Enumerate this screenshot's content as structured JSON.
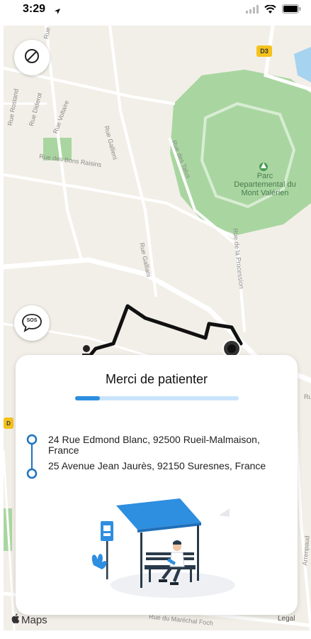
{
  "status_bar": {
    "time": "3:29",
    "location_icon": "navigation-arrow-icon",
    "signal_icon": "signal-bars-icon",
    "wifi_icon": "wifi-icon",
    "battery_icon": "battery-icon"
  },
  "map": {
    "road_labels": {
      "rue_gallieni_top": "Rue Gallieni",
      "rue_gallieni_mid": "Rue Gallieni",
      "rue_diderot": "Rue Diderot",
      "rue_rostand": "Rue Rostand",
      "rue_voltaire": "Rue Voltaire",
      "rue_bons_raisins": "Rue des Bons Raisins",
      "rue_talus": "Rue des Talus",
      "rue_galliani": "Rue Galliani",
      "rue_procession": "Rue de la Procession",
      "rue_marechal_foch": "Rue du Maréchal Foch",
      "arrenpaud": "Arrenpaud",
      "ru": "Ru"
    },
    "park_label": "Parc Departemental du Mont Valérien",
    "road_badge": "D3",
    "road_badge_side": "D",
    "maps_logo": "Maps",
    "legal": "Legal"
  },
  "controls": {
    "cancel_icon": "prohibit-icon",
    "sos_icon": "sos-bubble-icon",
    "sos_label": "SOS"
  },
  "card": {
    "title": "Merci de patienter",
    "progress": 0.15,
    "origin": "24 Rue Edmond Blanc, 92500 Rueil-Malmaison, France",
    "destination": "25 Avenue Jean Jaurès, 92150 Suresnes, France"
  },
  "colors": {
    "accent": "#2e8ee0",
    "route": "#111111",
    "park": "#a9d6a0"
  }
}
